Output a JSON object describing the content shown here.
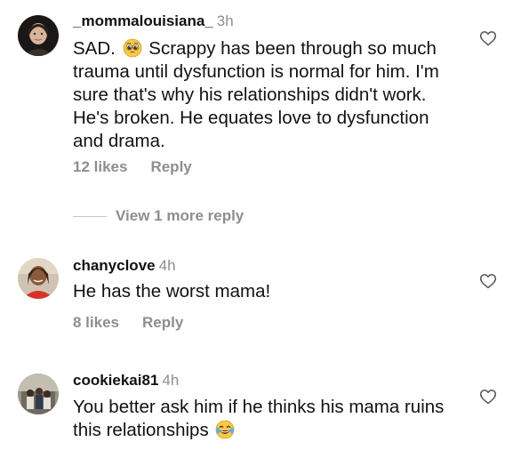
{
  "comments": [
    {
      "username": "_mommalouisiana_",
      "time": "3h",
      "text_before_emoji": "SAD.",
      "emoji": "pleading-face",
      "text_after_emoji": "Scrappy has been through so much trauma until dysfunction is normal for him. I'm sure that's why his relationships didn't work. He's broken. He equates love to dysfunction and drama.",
      "likes": "12 likes",
      "reply": "Reply"
    },
    {
      "username": "chanyclove",
      "time": "4h",
      "text": "He has the worst mama!",
      "likes": "8 likes",
      "reply": "Reply"
    },
    {
      "username": "cookiekai81",
      "time": "4h",
      "text": "You better ask him if he thinks his mama ruins this relationships",
      "emoji": "face-with-tears-of-joy"
    }
  ],
  "view_more_replies": "View 1 more reply",
  "icons": {
    "like": "heart-outline-icon"
  }
}
